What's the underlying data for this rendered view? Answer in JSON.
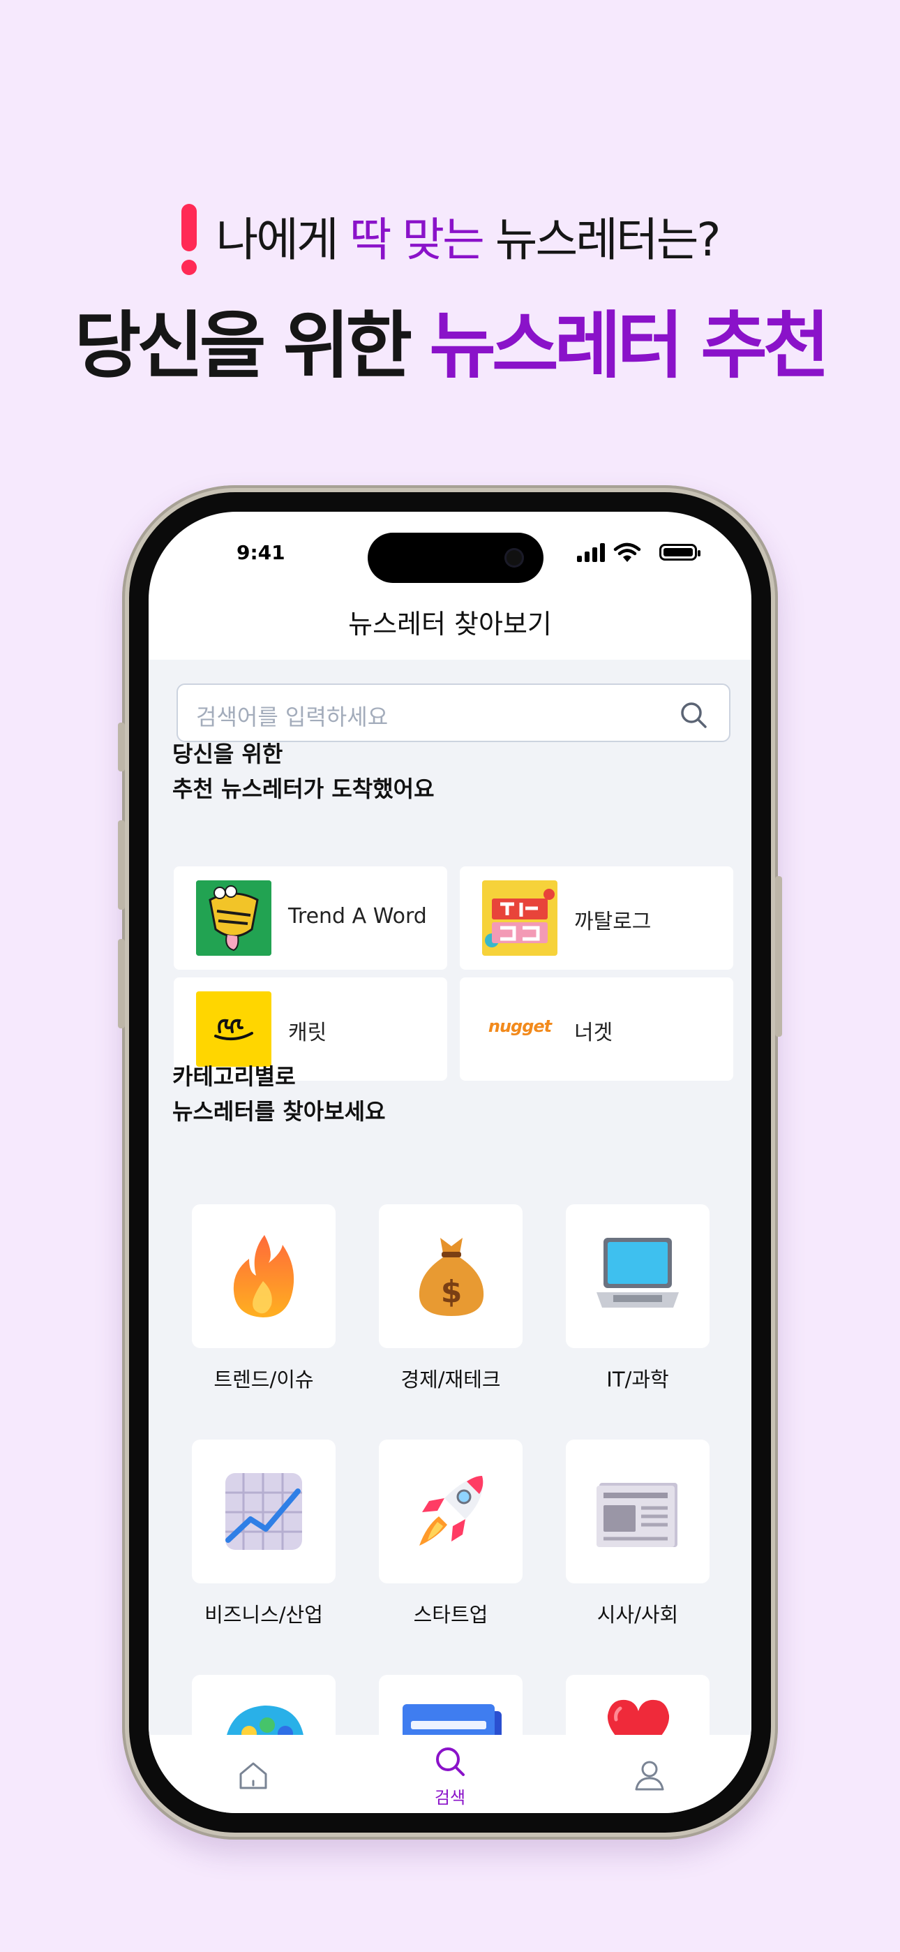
{
  "promo": {
    "line1_pre": "나에게 ",
    "line1_accent": "딱 맞는",
    "line1_post": " 뉴스레터는?",
    "line2_pre": "당신을 위한 ",
    "line2_accent": "뉴스레터 추천"
  },
  "status_bar": {
    "time": "9:41"
  },
  "app": {
    "title": "뉴스레터 찾아보기",
    "search_placeholder": "검색어를 입력하세요",
    "reco_title_1": "당신을 위한",
    "reco_title_2": "추천 뉴스레터가 도착했어요",
    "recommendations": [
      {
        "name": "Trend A Word",
        "logo": "trend-a-word-logo"
      },
      {
        "name": "까탈로그",
        "logo": "katalog-logo"
      },
      {
        "name": "캐릿",
        "logo": "careet-logo"
      },
      {
        "name": "너겟",
        "logo": "nugget-logo",
        "logo_text": "nugget"
      }
    ],
    "category_title_1": "카테고리별로",
    "category_title_2": "뉴스레터를 찾아보세요",
    "categories": [
      {
        "label": "트렌드/이슈",
        "icon": "fire-icon"
      },
      {
        "label": "경제/재테크",
        "icon": "money-bag-icon"
      },
      {
        "label": "IT/과학",
        "icon": "laptop-icon"
      },
      {
        "label": "비즈니스/산업",
        "icon": "chart-increasing-icon"
      },
      {
        "label": "스타트업",
        "icon": "rocket-icon"
      },
      {
        "label": "시사/사회",
        "icon": "newspaper-icon"
      }
    ],
    "tabs": [
      {
        "label": "",
        "icon": "home-icon",
        "active": false
      },
      {
        "label": "검색",
        "icon": "search-icon",
        "active": true
      },
      {
        "label": "",
        "icon": "profile-icon",
        "active": false
      }
    ]
  },
  "colors": {
    "accent": "#8a12c9",
    "background": "#f6e9fd",
    "content_bg": "#f1f3f7"
  }
}
